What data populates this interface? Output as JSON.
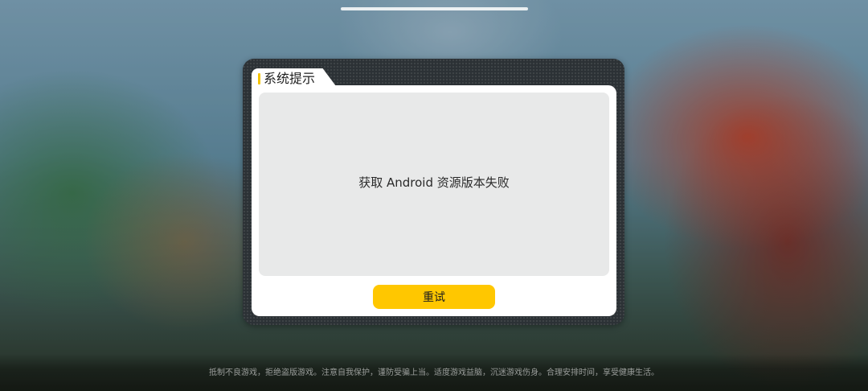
{
  "dialog": {
    "title": "系统提示",
    "message": "获取 Android 资源版本失败",
    "retry_label": "重试"
  },
  "footer": {
    "notice": "抵制不良游戏，拒绝盗版游戏。注意自我保护，谨防受骗上当。适度游戏益脑，沉迷游戏伤身。合理安排时间，享受健康生活。"
  },
  "colors": {
    "accent": "#ffc700",
    "dialog_frame": "#2c3135",
    "content_box": "#e8e9e9"
  }
}
